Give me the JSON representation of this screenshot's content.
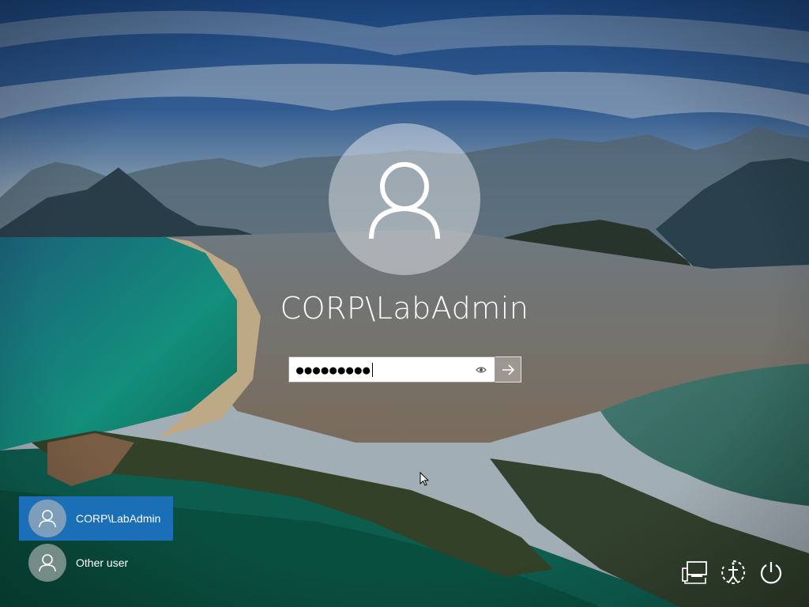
{
  "login": {
    "username": "CORP\\LabAdmin",
    "password_mask": "●●●●●●●●●"
  },
  "user_list": [
    {
      "label": "CORP\\LabAdmin",
      "selected": true
    },
    {
      "label": "Other user",
      "selected": false
    }
  ],
  "icons": {
    "avatar": "user-icon",
    "reveal": "eye-icon",
    "submit": "arrow-right-icon",
    "network": "network-icon",
    "ease_of_access": "ease-of-access-icon",
    "power": "power-icon"
  },
  "colors": {
    "selected_user": "#1a6fb7",
    "text": "#ffffff"
  }
}
